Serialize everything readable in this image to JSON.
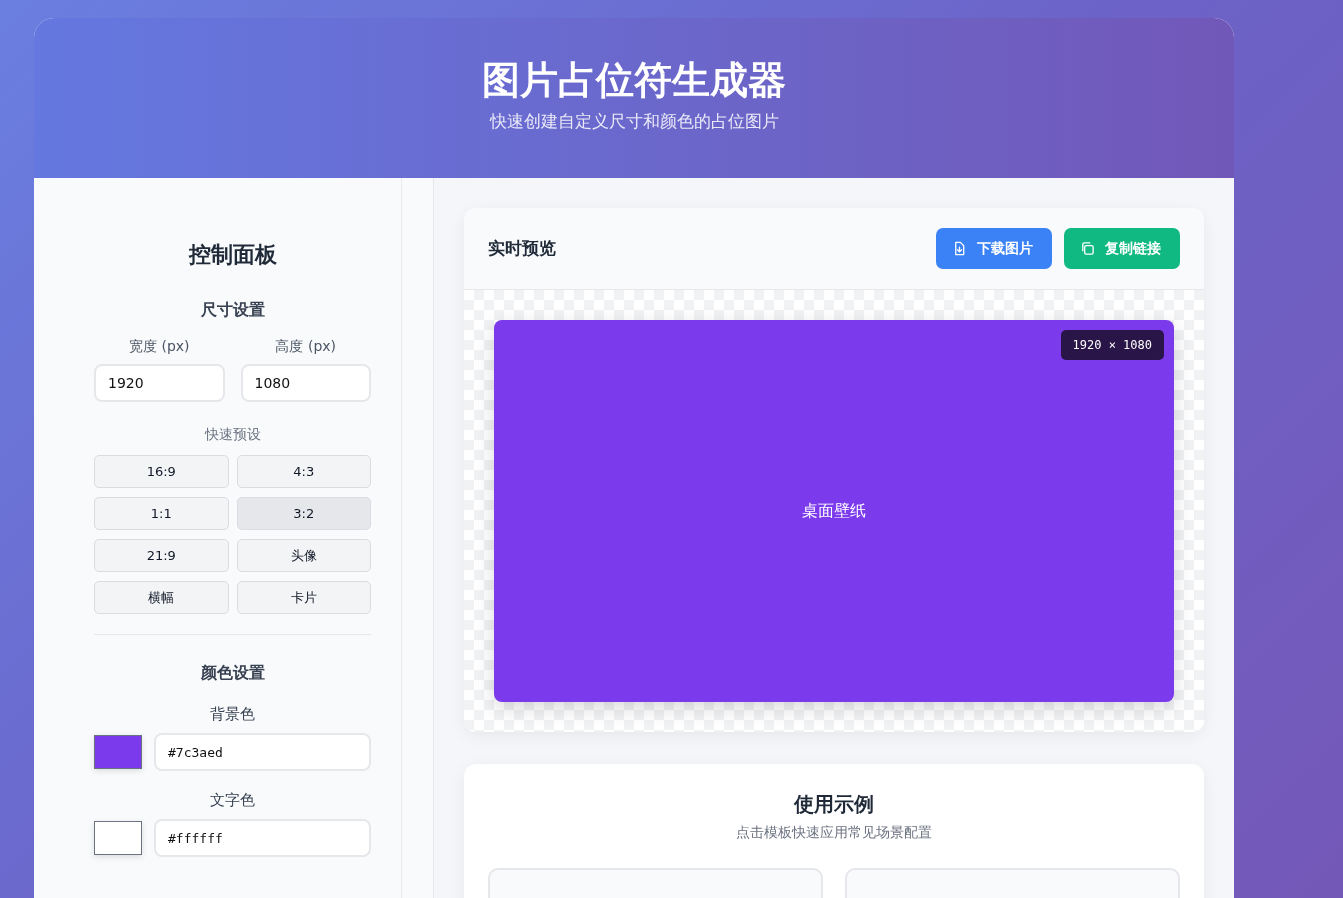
{
  "header": {
    "title": "图片占位符生成器",
    "subtitle": "快速创建自定义尺寸和颜色的占位图片"
  },
  "control_panel": {
    "title": "控制面板",
    "size_section": {
      "title": "尺寸设置",
      "width": {
        "label": "宽度 (px)",
        "value": "1920"
      },
      "height": {
        "label": "高度 (px)",
        "value": "1080"
      },
      "presets_label": "快速预设",
      "presets": [
        {
          "label": "16:9",
          "selected": false
        },
        {
          "label": "4:3",
          "selected": false
        },
        {
          "label": "1:1",
          "selected": false
        },
        {
          "label": "3:2",
          "selected": true
        },
        {
          "label": "21:9",
          "selected": false
        },
        {
          "label": "头像",
          "selected": false
        },
        {
          "label": "横幅",
          "selected": false
        },
        {
          "label": "卡片",
          "selected": false
        }
      ]
    },
    "color_section": {
      "title": "颜色设置",
      "colors": [
        {
          "label": "背景色",
          "color": "#7c3aed",
          "value": "#7c3aed"
        },
        {
          "label": "文字色",
          "color": "#ffffff",
          "value": "#ffffff"
        }
      ]
    }
  },
  "preview": {
    "title": "实时预览",
    "buttons": [
      {
        "label": "下载图片",
        "kind": "download"
      },
      {
        "label": "复制链接",
        "kind": "copy"
      }
    ],
    "image": {
      "color": "#7c3aed",
      "text": "桌面壁纸",
      "size_badge": "1920 × 1080"
    }
  },
  "examples": {
    "title": "使用示例",
    "subtitle": "点击模板快速应用常见场景配置",
    "cards": [
      {
        "kind": "template"
      },
      {
        "kind": "template"
      }
    ]
  }
}
